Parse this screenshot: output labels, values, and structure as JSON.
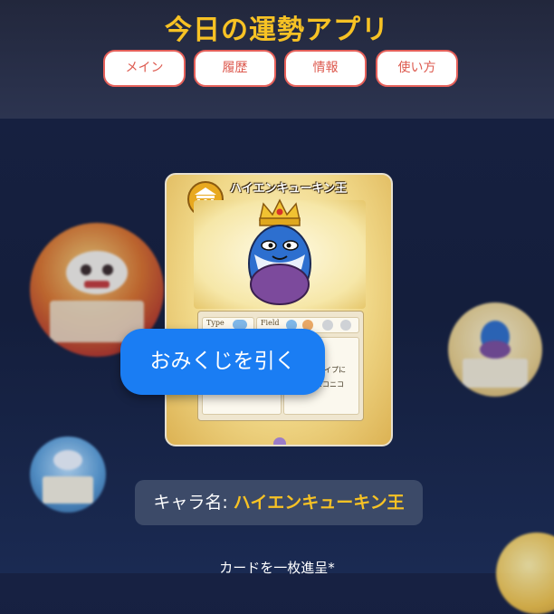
{
  "app": {
    "title": "今日の運勢アプリ"
  },
  "nav": [
    {
      "label": "メイン"
    },
    {
      "label": "履歴"
    },
    {
      "label": "情報"
    },
    {
      "label": "使い方"
    }
  ],
  "card": {
    "name": "ハイエンキューキン王",
    "type_label": "Type",
    "field_label": "Field",
    "text_lines": [
      "イプに",
      "ニコニコ"
    ],
    "emblem_icon": "temple-icon",
    "character_icon": "crowned-king-egg-character"
  },
  "actions": {
    "draw_label": "おみくじを引く"
  },
  "result": {
    "label": "キャラ名: ",
    "value": "ハイエンキューキン王"
  },
  "footer": {
    "note": "カードを一枚進呈*"
  },
  "colors": {
    "accent_yellow": "#f7c224",
    "nav_border": "#e5605a",
    "primary_button": "#1a7df3",
    "background": "#141e3c"
  }
}
